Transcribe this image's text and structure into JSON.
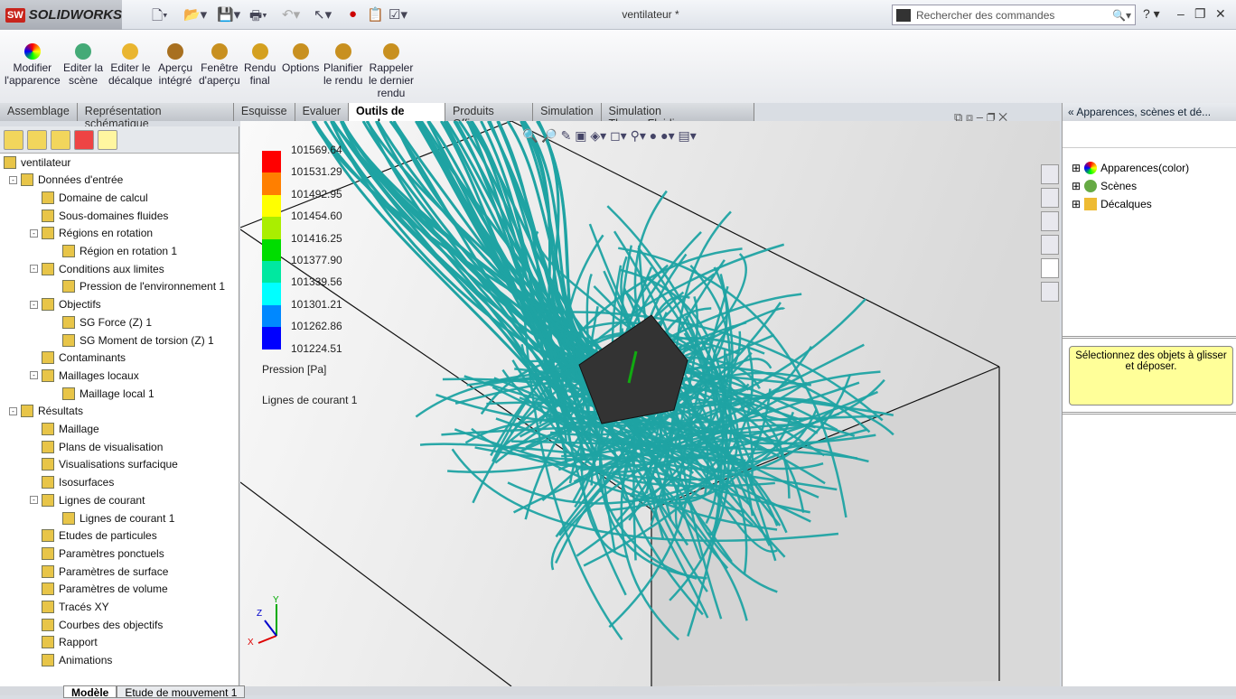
{
  "app": {
    "brand": "SOLIDWORKS",
    "doc_title": "ventilateur *",
    "search_placeholder": "Rechercher des commandes"
  },
  "ribbon": [
    "Modifier\nl'apparence",
    "Editer la\nscène",
    "Editer le\ndécalque",
    "Aperçu\nintégré",
    "Fenêtre\nd'aperçu",
    "Rendu\nfinal",
    "Options",
    "Planifier\nle rendu",
    "Rappeler\nle dernier\nrendu"
  ],
  "tabs": [
    "Assemblage",
    "Représentation schématique",
    "Esquisse",
    "Evaluer",
    "Outils de rendu",
    "Produits Office",
    "Simulation",
    "Simulation ThermoFluidique"
  ],
  "active_tab": "Outils de rendu",
  "tree": [
    {
      "label": "ventilateur",
      "level": 0
    },
    {
      "label": "Données d'entrée",
      "level": 1,
      "pm": "-"
    },
    {
      "label": "Domaine de calcul",
      "level": 2
    },
    {
      "label": "Sous-domaines fluides",
      "level": 2
    },
    {
      "label": "Régions en rotation",
      "level": 2,
      "pm": "-"
    },
    {
      "label": "Région en rotation 1",
      "level": 3
    },
    {
      "label": "Conditions aux limites",
      "level": 2,
      "pm": "-"
    },
    {
      "label": "Pression de l'environnement 1",
      "level": 3
    },
    {
      "label": "Objectifs",
      "level": 2,
      "pm": "-"
    },
    {
      "label": "SG Force (Z) 1",
      "level": 3
    },
    {
      "label": "SG Moment de torsion (Z) 1",
      "level": 3
    },
    {
      "label": "Contaminants",
      "level": 2
    },
    {
      "label": "Maillages locaux",
      "level": 2,
      "pm": "-"
    },
    {
      "label": "Maillage local 1",
      "level": 3
    },
    {
      "label": "Résultats",
      "level": 1,
      "pm": "-"
    },
    {
      "label": "Maillage",
      "level": 2
    },
    {
      "label": "Plans de visualisation",
      "level": 2
    },
    {
      "label": "Visualisations surfacique",
      "level": 2
    },
    {
      "label": "Isosurfaces",
      "level": 2
    },
    {
      "label": "Lignes de courant",
      "level": 2,
      "pm": "-"
    },
    {
      "label": "Lignes de courant 1",
      "level": 3
    },
    {
      "label": "Etudes de particules",
      "level": 2
    },
    {
      "label": "Paramètres ponctuels",
      "level": 2
    },
    {
      "label": "Paramètres de surface",
      "level": 2
    },
    {
      "label": "Paramètres de volume",
      "level": 2
    },
    {
      "label": "Tracés XY",
      "level": 2
    },
    {
      "label": "Courbes des objectifs",
      "level": 2
    },
    {
      "label": "Rapport",
      "level": 2
    },
    {
      "label": "Animations",
      "level": 2
    }
  ],
  "legend": {
    "values": [
      "101569.64",
      "101531.29",
      "101492.95",
      "101454.60",
      "101416.25",
      "101377.90",
      "101339.56",
      "101301.21",
      "101262.86",
      "101224.51"
    ],
    "colors": [
      "#ff0000",
      "#ff7f00",
      "#ffff00",
      "#aaee00",
      "#00dd00",
      "#00e8a0",
      "#00ffff",
      "#0088ff",
      "#0000ff"
    ],
    "title": "Pression [Pa]",
    "subtitle": "Lignes de courant 1"
  },
  "streamline_color": "#1fa3a3",
  "right_panel": {
    "title": "Apparences, scènes et dé...",
    "items": [
      "Apparences(color)",
      "Scènes",
      "Décalques"
    ],
    "hint": "Sélectionnez des objets à glisser et déposer."
  },
  "bottom_tabs": [
    "Modèle",
    "Etude de mouvement 1"
  ],
  "triad": {
    "x": "X",
    "y": "Y",
    "z": "Z"
  }
}
